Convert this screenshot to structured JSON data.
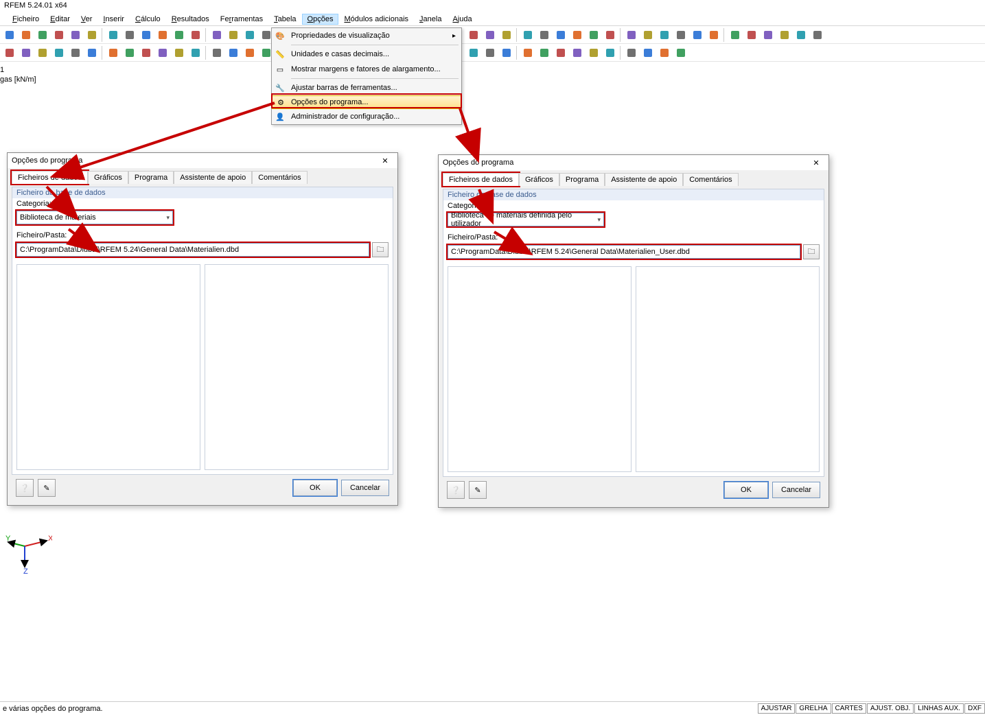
{
  "app": {
    "title": "RFEM 5.24.01 x64"
  },
  "menubar": {
    "items": [
      "Ficheiro",
      "Editar",
      "Ver",
      "Inserir",
      "Cálculo",
      "Resultados",
      "Ferramentas",
      "Tabela",
      "Opções",
      "Módulos adicionais",
      "Janela",
      "Ajuda"
    ],
    "open_index": 8
  },
  "dropdown": {
    "items": [
      {
        "label": "Propriedades de visualização",
        "arrow": true
      },
      {
        "sep": true
      },
      {
        "label": "Unidades e casas decimais..."
      },
      {
        "label": "Mostrar margens e fatores de alargamento..."
      },
      {
        "sep": true
      },
      {
        "label": "Ajustar barras de ferramentas..."
      },
      {
        "label": "Opções do programa...",
        "highlight": true
      },
      {
        "label": "Administrador de configuração..."
      }
    ]
  },
  "annotation": {
    "line1": "1",
    "line2": "gas [kN/m]"
  },
  "dialog_left": {
    "title": "Opções do programa",
    "tabs": [
      "Ficheiros de dados",
      "Gráficos",
      "Programa",
      "Assistente de apoio",
      "Comentários"
    ],
    "active_tab": 0,
    "group_title": "Ficheiro da base de dados",
    "category_label": "Categoria:",
    "category_value": "Biblioteca de materiais",
    "path_label": "Ficheiro/Pasta:",
    "path_value": "C:\\ProgramData\\Dlubal\\RFEM 5.24\\General Data\\Materialien.dbd",
    "ok": "OK",
    "cancel": "Cancelar"
  },
  "dialog_right": {
    "title": "Opções do programa",
    "tabs": [
      "Ficheiros de dados",
      "Gráficos",
      "Programa",
      "Assistente de apoio",
      "Comentários"
    ],
    "active_tab": 0,
    "group_title": "Ficheiro da base de dados",
    "category_label": "Categoria:",
    "category_value": "Biblioteca de materiais definida pelo utilizador",
    "path_label": "Ficheiro/Pasta:",
    "path_value": "C:\\ProgramData\\Dlubal\\RFEM 5.24\\General Data\\Materialien_User.dbd",
    "ok": "OK",
    "cancel": "Cancelar"
  },
  "statusbar": {
    "message": "e várias opções do programa.",
    "cells": [
      "AJUSTAR",
      "GRELHA",
      "CARTES",
      "AJUST. OBJ.",
      "LINHAS AUX.",
      "DXF"
    ]
  },
  "axis": {
    "x": "X",
    "y": "Y",
    "z": "Z"
  },
  "colors": {
    "accent": "#c60000"
  }
}
